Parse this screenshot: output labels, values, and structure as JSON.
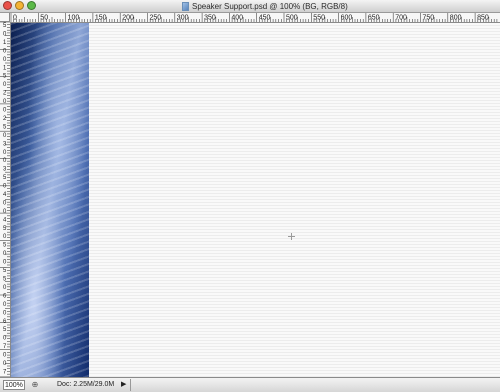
{
  "window": {
    "title": "Speaker Support.psd @ 100% (BG, RGB/8)"
  },
  "ruler": {
    "horizontal_labels": [
      "0",
      "50",
      "100",
      "150",
      "200",
      "250",
      "300",
      "350",
      "400",
      "450",
      "500",
      "550",
      "600",
      "650",
      "700",
      "750",
      "800",
      "850"
    ],
    "vertical_labels": [
      "5",
      "0",
      "1",
      "0",
      "0",
      "1",
      "5",
      "0",
      "2",
      "0",
      "0",
      "2",
      "5",
      "0",
      "3",
      "0",
      "0",
      "3",
      "5",
      "0",
      "4",
      "0",
      "0",
      "4",
      "5",
      "0",
      "5",
      "0",
      "0",
      "5",
      "5",
      "0",
      "6",
      "0",
      "0",
      "6",
      "5",
      "0",
      "7",
      "0",
      "0",
      "7"
    ]
  },
  "statusbar": {
    "zoom": "100%",
    "doc_info": "Doc: 2.25M/29.0M",
    "arrow_icon": "triangle-right-icon",
    "status_icon": "info-icon"
  },
  "colors": {
    "image_dark_blue": "#0b1e4e",
    "image_mid_blue": "#4d6eb2",
    "image_light_blue": "#8ea6d6"
  }
}
